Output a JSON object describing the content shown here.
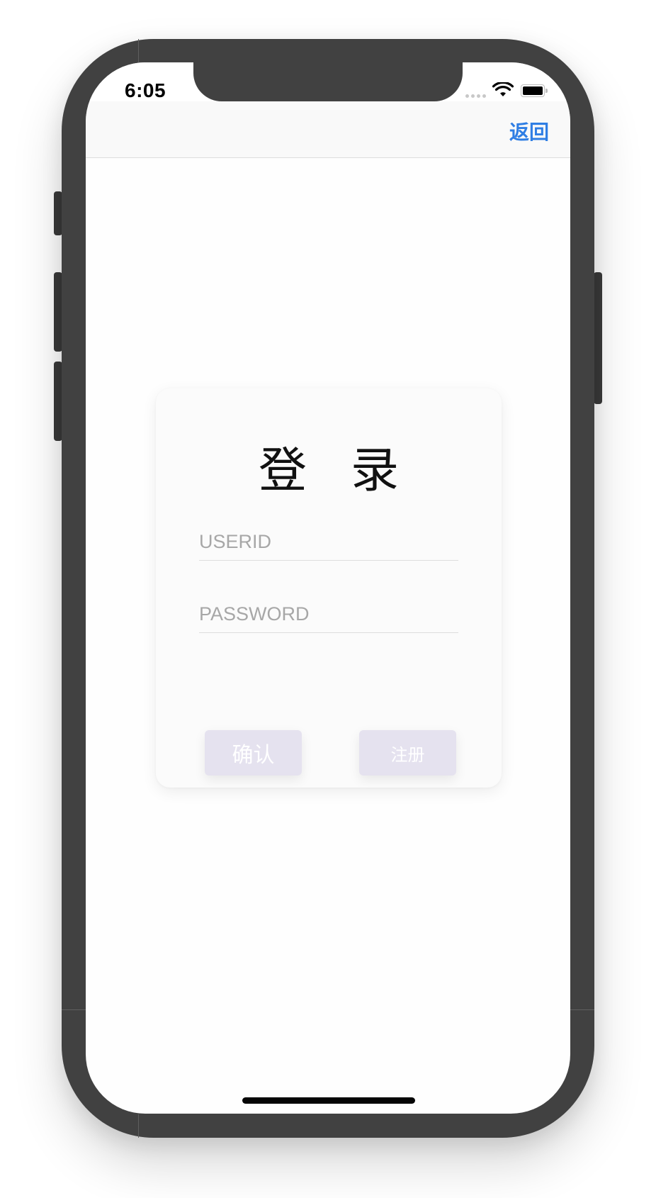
{
  "status_bar": {
    "time": "6:05",
    "wifi_icon": "wifi-icon",
    "battery_icon": "battery-full-icon"
  },
  "nav": {
    "back_label": "返回",
    "accent_color": "#2f7ee4"
  },
  "login": {
    "title": "登录",
    "userid_placeholder": "USERID",
    "userid_value": "",
    "password_placeholder": "PASSWORD",
    "password_value": "",
    "confirm_label": "确认",
    "register_label": "注册",
    "button_color": "#e5e2ef"
  },
  "colors": {
    "device_frame": "#414141",
    "screen_background": "#fefefe",
    "nav_background": "#f9f9f9"
  }
}
